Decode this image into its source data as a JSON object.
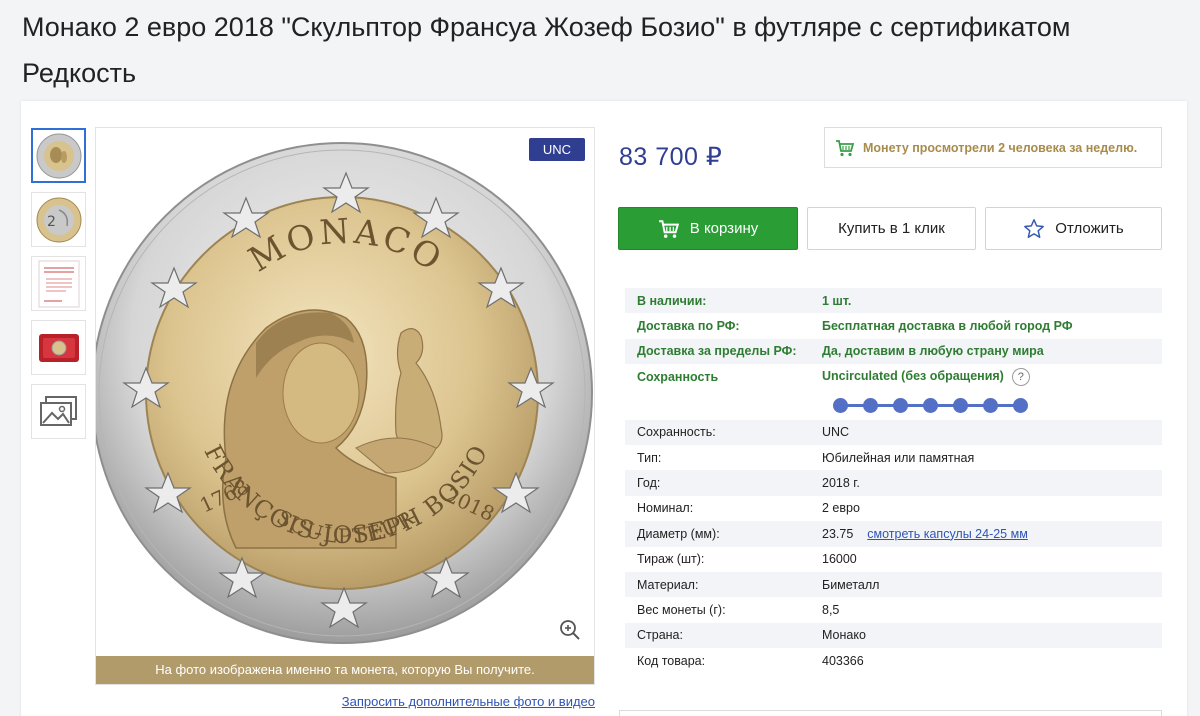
{
  "page": {
    "title": "Монако 2 евро 2018 \"Скульптор Франсуа Жозеф Бозио\" в футляре с сертификатом Редкость"
  },
  "gallery": {
    "badge": "UNC",
    "caption": "На фото изображена именно та монета, которую Вы получите.",
    "request_link": "Запросить дополнительные фото и видео",
    "thumbnails": [
      "coin-obverse",
      "coin-reverse",
      "certificate",
      "case",
      "more-photos"
    ],
    "coin_text": {
      "country": "MONACO",
      "name": "FRANÇOIS-JOSEPH BOSIO",
      "year_left": "1768",
      "year_right": "2018",
      "profession": "SCULPTEUR",
      "reverse_value": "2"
    }
  },
  "product": {
    "price": "83 700 ₽",
    "views_notice": "Монету просмотрели 2 человека за неделю.",
    "cart_button": "В корзину",
    "one_click_button": "Купить в 1 клик",
    "wishlist_button": "Отложить"
  },
  "availability": [
    {
      "key": "В наличии:",
      "value": "1 шт."
    },
    {
      "key": "Доставка по РФ:",
      "value": "Бесплатная доставка в любой город РФ"
    },
    {
      "key": "Доставка за пределы РФ:",
      "value": "Да, доставим в любую страну мира"
    },
    {
      "key": "Сохранность",
      "value": "Uncirculated (без обращения)"
    }
  ],
  "grade_level": {
    "current": 7,
    "max": 7
  },
  "specs": [
    {
      "key": "Сохранность:",
      "value": "UNC"
    },
    {
      "key": "Тип:",
      "value": "Юбилейная или памятная"
    },
    {
      "key": "Год:",
      "value": "2018 г."
    },
    {
      "key": "Номинал:",
      "value": "2 евро"
    },
    {
      "key": "Диаметр (мм):",
      "value": "23.75",
      "link": "смотреть капсулы 24-25 мм"
    },
    {
      "key": "Тираж (шт):",
      "value": "16000"
    },
    {
      "key": "Материал:",
      "value": "Биметалл"
    },
    {
      "key": "Вес монеты (г):",
      "value": "8,5"
    },
    {
      "key": "Страна:",
      "value": "Монако"
    },
    {
      "key": "Код товара:",
      "value": "403366"
    }
  ],
  "colors": {
    "accent_blue": "#2f3e91",
    "cart_green": "#2a9d35",
    "availability_green": "#2e7d32",
    "caption_gold": "#b29b6b",
    "views_gold": "#a88b4a"
  }
}
